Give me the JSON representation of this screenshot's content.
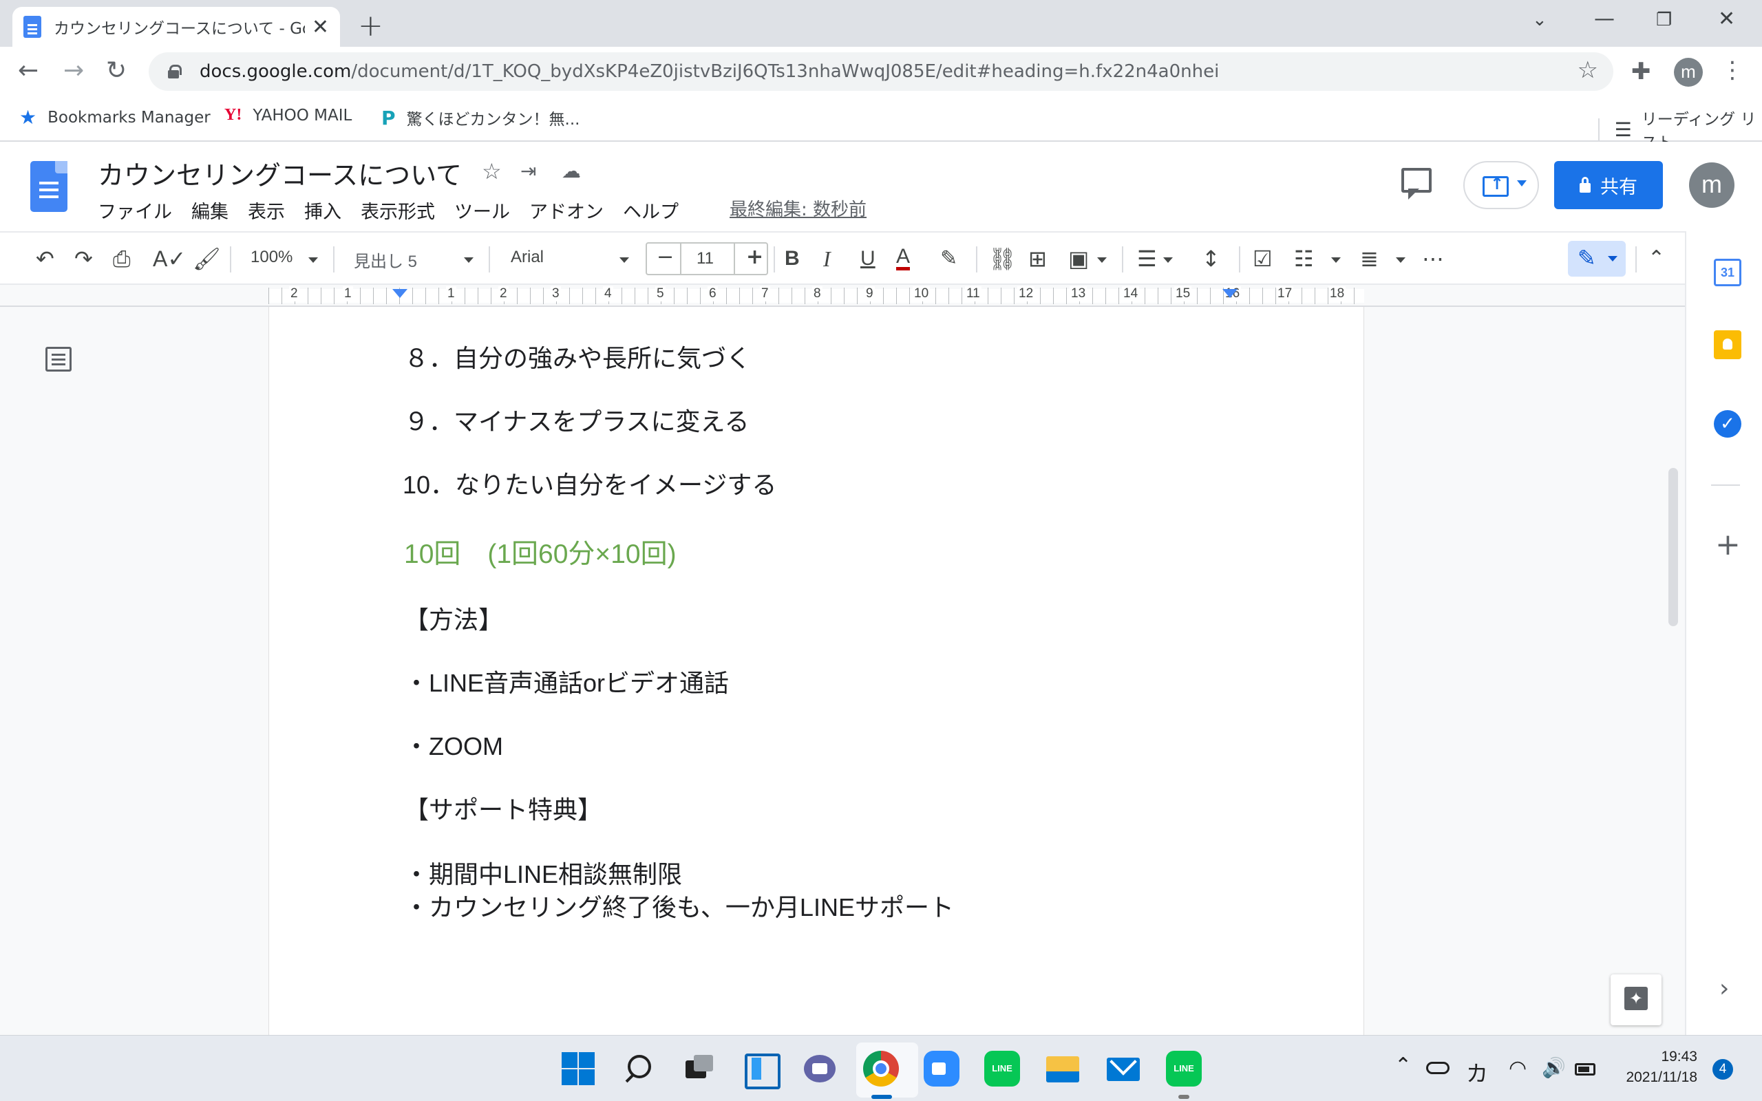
{
  "browser": {
    "tab_title": "カウンセリングコースについて - Google ドキュメント",
    "tab_close": "✕",
    "new_tab": "+",
    "url_host": "docs.google.com",
    "url_path": "/document/d/1T_KOQ_bydXsKP4eZ0jistvBziJ6QTs13nhaWwqJ085E/edit#heading=h.fx22n4a0nhei",
    "profile_initial": "m",
    "bookmarks": [
      {
        "label": "Bookmarks Manager",
        "icon": "star-icon"
      },
      {
        "label": "YAHOO MAIL",
        "icon": "yahoo-icon"
      },
      {
        "label": "驚くほどカンタン！無...",
        "icon": "bookmark-site-icon"
      }
    ],
    "reading_list": "リーディング リスト"
  },
  "docs": {
    "title": "カウンセリングコースについて",
    "menu": [
      "ファイル",
      "編集",
      "表示",
      "挿入",
      "表示形式",
      "ツール",
      "アドオン",
      "ヘルプ"
    ],
    "last_edit": "最終編集: 数秒前",
    "share_label": "共有",
    "account_initial": "m",
    "accent_color": "#1a73e8"
  },
  "toolbar": {
    "zoom": "100%",
    "style": "見出し 5",
    "font": "Arial",
    "font_size": "11"
  },
  "ruler": {
    "left_numbers": [
      "2",
      "1"
    ],
    "numbers": [
      "1",
      "2",
      "3",
      "4",
      "5",
      "6",
      "7",
      "8",
      "9",
      "10",
      "11",
      "12",
      "13",
      "14",
      "15",
      "16",
      "17",
      "18"
    ]
  },
  "document": {
    "heading_color": "#6aa84f",
    "lines": [
      {
        "text": "８．自分の強みや長所に気づく",
        "style": "normal"
      },
      {
        "text": "９．マイナスをプラスに変える",
        "style": "normal"
      },
      {
        "text": "10．なりたい自分をイメージする",
        "style": "normal"
      },
      {
        "text": "10回　(1回60分×10回)",
        "style": "heading5"
      },
      {
        "text": "【方法】",
        "style": "normal"
      },
      {
        "text": "・LINE音声通話orビデオ通話",
        "style": "normal"
      },
      {
        "text": "・ZOOM",
        "style": "normal"
      },
      {
        "text": "【サポート特典】",
        "style": "normal"
      },
      {
        "text": "・期間中LINE相談無制限",
        "style": "normal"
      },
      {
        "text": "・カウンセリング終了後も、一か月LINEサポート",
        "style": "normal"
      }
    ]
  },
  "side_panel": {
    "calendar_day": "31"
  },
  "taskbar": {
    "line_label": "LINE",
    "ime": "カ",
    "time": "19:43",
    "date": "2021/11/18",
    "notifications": "4"
  }
}
